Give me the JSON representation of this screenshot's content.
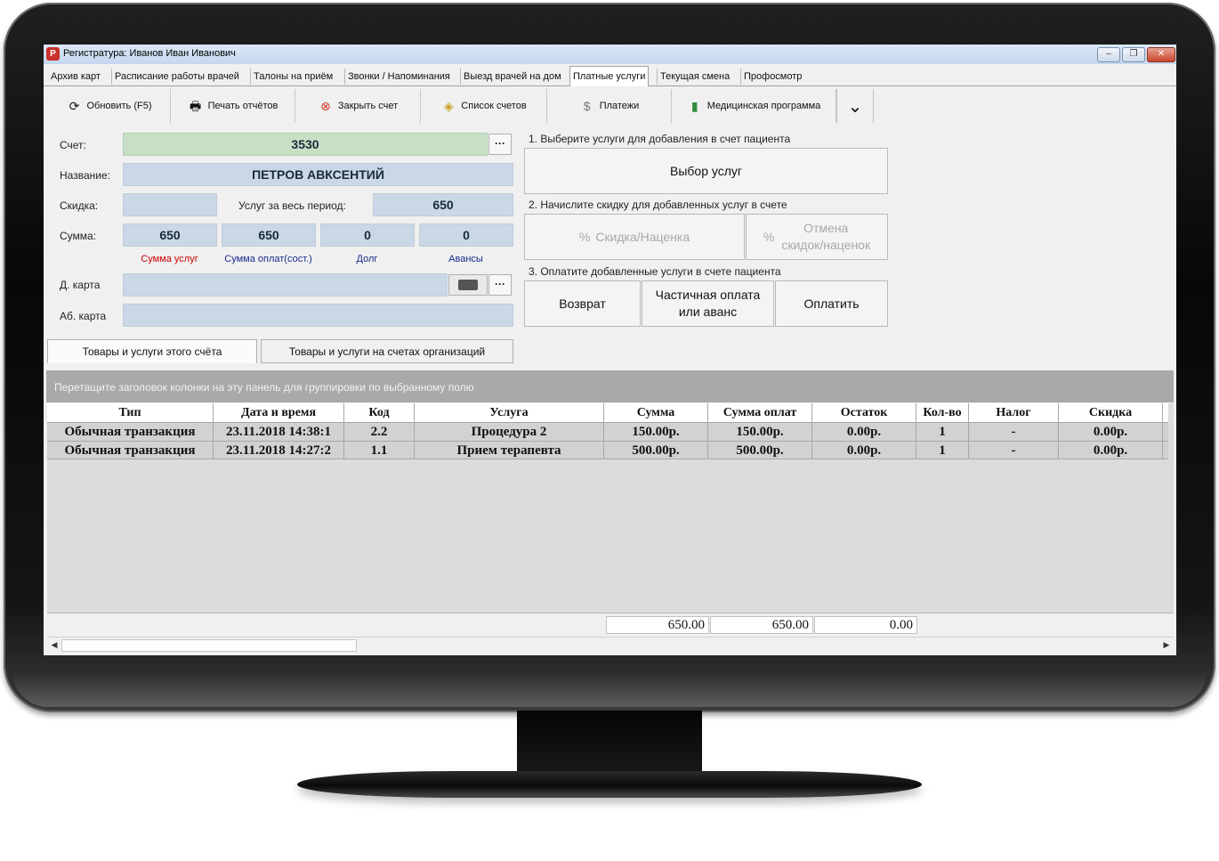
{
  "window": {
    "title": "Регистратура: Иванов Иван Иванович",
    "icon": "app-logo-icon",
    "controls": {
      "min": "–",
      "max": "❐",
      "close": "✕"
    }
  },
  "tabs": [
    {
      "label": "Архив карт"
    },
    {
      "label": "Расписание работы врачей"
    },
    {
      "label": "Талоны на приём"
    },
    {
      "label": "Звонки / Напоминания"
    },
    {
      "label": "Выезд врачей на дом"
    },
    {
      "label": "Платные услуги",
      "active": true
    },
    {
      "label": "Текущая смена"
    },
    {
      "label": "Профосмотр"
    }
  ],
  "toolbar": {
    "refresh": "Обновить (F5)",
    "print": "Печать отчётов",
    "close_account": "Закрыть счет",
    "accounts_list": "Список счетов",
    "payments": "Платежи",
    "med_program": "Медицинская программа",
    "more_icon": "⌄"
  },
  "form": {
    "account_label": "Счет:",
    "account_value": "3530",
    "name_label": "Название:",
    "name_value": "ПЕТРОВ АВКСЕНТИЙ",
    "discount_label": "Скидка:",
    "discount_value": "",
    "period_label": "Услуг за весь период:",
    "period_value": "650",
    "sum_label": "Сумма:",
    "sum_services": "650",
    "sum_paid": "650",
    "debt": "0",
    "advances": "0",
    "sum_services_caption": "Сумма услуг",
    "sum_paid_caption": "Сумма оплат(сост.)",
    "debt_caption": "Долг",
    "advances_caption": "Авансы",
    "dcard_label": "Д. карта",
    "abcard_label": "Аб. карта",
    "ellipsis": "···"
  },
  "steps": {
    "step1": "1. Выберите услуги для добавления в счет пациента",
    "select_services": "Выбор услуг",
    "step2": "2. Начислите скидку для добавленных услуг в счете",
    "discount_markup": "Скидка/Наценка",
    "cancel_discounts_line1": "Отмена",
    "cancel_discounts_line2": "скидок/наценок",
    "step3": "3. Оплатите добавленные услуги в счете пациента",
    "refund": "Возврат",
    "partial_line1": "Частичная оплата",
    "partial_line2": "или аванс",
    "pay": "Оплатить"
  },
  "subtabs": {
    "this_account": "Товары и услуги этого счёта",
    "org_accounts": "Товары и услуги на счетах организаций"
  },
  "grid": {
    "group_hint": "Перетащите заголовок колонки на эту панель для группировки по выбранному полю",
    "columns": [
      "Тип",
      "Дата и время",
      "Код",
      "Услуга",
      "Сумма",
      "Сумма оплат",
      "Остаток",
      "Кол-во",
      "Налог",
      "Скидка"
    ],
    "rows": [
      [
        "Обычная транзакция",
        "23.11.2018 14:38:1",
        "2.2",
        "Процедура 2",
        "150.00р.",
        "150.00р.",
        "0.00р.",
        "1",
        "-",
        "0.00р."
      ],
      [
        "Обычная транзакция",
        "23.11.2018 14:27:2",
        "1.1",
        "Прием терапевта",
        "500.00р.",
        "500.00р.",
        "0.00р.",
        "1",
        "-",
        "0.00р."
      ]
    ],
    "totals": {
      "sum": "650.00",
      "paid": "650.00",
      "rest": "0.00"
    }
  },
  "colors": {
    "field_blue": "#c9d7e6",
    "field_green": "#c8dfc6",
    "caption_red": "#cc0000",
    "caption_blue": "#1a2a8a"
  }
}
